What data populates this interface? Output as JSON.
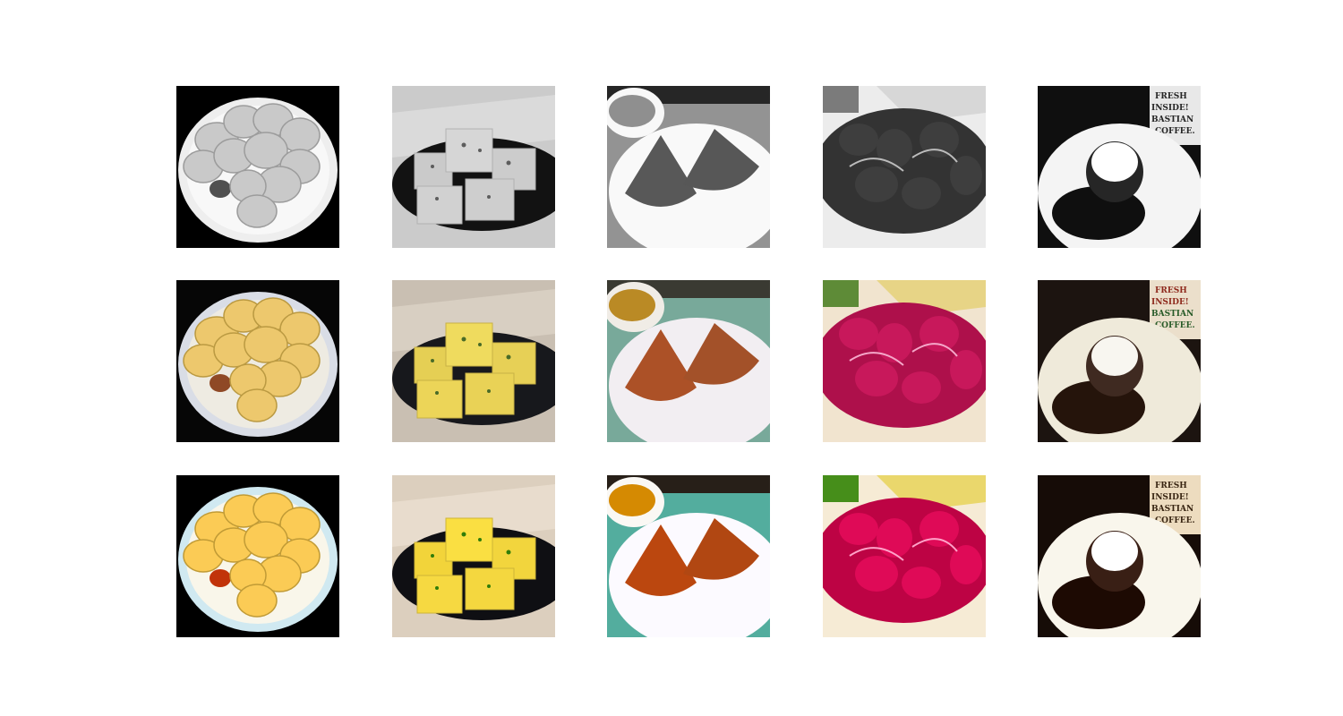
{
  "figure": {
    "rows": [
      {
        "role": "grayscale-input",
        "cells": [
          "momos",
          "dhokla",
          "samosa",
          "beet-curry",
          "chocolate-dessert"
        ]
      },
      {
        "role": "colorized-output",
        "cells": [
          "momos",
          "dhokla",
          "samosa",
          "beet-curry",
          "chocolate-dessert"
        ]
      },
      {
        "role": "original-color",
        "cells": [
          "momos",
          "dhokla",
          "samosa",
          "beet-curry",
          "chocolate-dessert"
        ]
      }
    ],
    "cup_text": [
      "FRESH",
      "INSIDE!",
      "BASTIAN",
      "COFFEE."
    ],
    "colors": {
      "momo": "#e8c46a",
      "dhokla": "#e6cf5a",
      "samosa": "#b4582a",
      "beet": "#b0184a",
      "chocolate": "#2a1a14",
      "cream": "#f6f4ec"
    }
  }
}
